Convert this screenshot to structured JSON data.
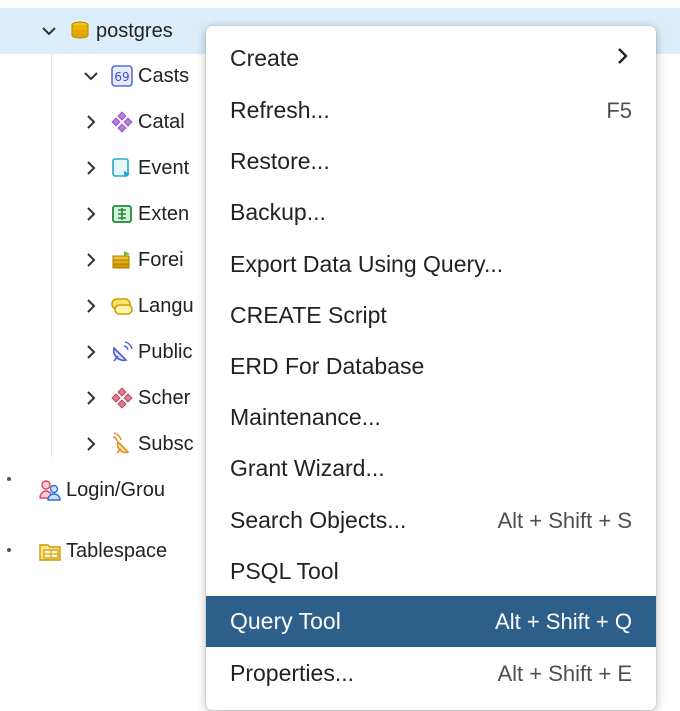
{
  "tree": {
    "root": {
      "label": "postgres",
      "icon": "database-icon",
      "expanded": true
    },
    "children": [
      {
        "label": "Casts",
        "icon": "casts-icon",
        "expanded": true
      },
      {
        "label": "Catal",
        "icon": "catalogs-icon",
        "expanded": false
      },
      {
        "label": "Event",
        "icon": "event-triggers-icon",
        "expanded": false
      },
      {
        "label": "Exten",
        "icon": "extensions-icon",
        "expanded": false
      },
      {
        "label": "Forei",
        "icon": "foreign-data-wrappers-icon",
        "expanded": false
      },
      {
        "label": "Langu",
        "icon": "languages-icon",
        "expanded": false
      },
      {
        "label": "Public",
        "icon": "publications-icon",
        "expanded": false
      },
      {
        "label": "Scher",
        "icon": "schemas-icon",
        "expanded": false
      },
      {
        "label": "Subsc",
        "icon": "subscriptions-icon",
        "expanded": false
      }
    ],
    "siblings": [
      {
        "label": "Login/Grou",
        "icon": "login-group-roles-icon"
      },
      {
        "label": "Tablespace",
        "icon": "tablespaces-icon"
      }
    ]
  },
  "menu": {
    "items": [
      {
        "label": "Create",
        "shortcut": "",
        "submenu": true
      },
      {
        "label": "Refresh...",
        "shortcut": "F5"
      },
      {
        "label": "Restore...",
        "shortcut": ""
      },
      {
        "label": "Backup...",
        "shortcut": ""
      },
      {
        "label": "Export Data Using Query...",
        "shortcut": ""
      },
      {
        "label": "CREATE Script",
        "shortcut": ""
      },
      {
        "label": "ERD For Database",
        "shortcut": ""
      },
      {
        "label": "Maintenance...",
        "shortcut": ""
      },
      {
        "label": "Grant Wizard...",
        "shortcut": ""
      },
      {
        "label": "Search Objects...",
        "shortcut": "Alt + Shift + S"
      },
      {
        "label": "PSQL Tool",
        "shortcut": ""
      },
      {
        "label": "Query Tool",
        "shortcut": "Alt + Shift + Q",
        "highlighted": true
      },
      {
        "label": "Properties...",
        "shortcut": "Alt + Shift + E"
      }
    ]
  },
  "colors": {
    "selected_row": "#dceefa",
    "menu_highlight": "#2d5f8b",
    "menu_text": "#222222",
    "shortcut_text": "#505050"
  }
}
